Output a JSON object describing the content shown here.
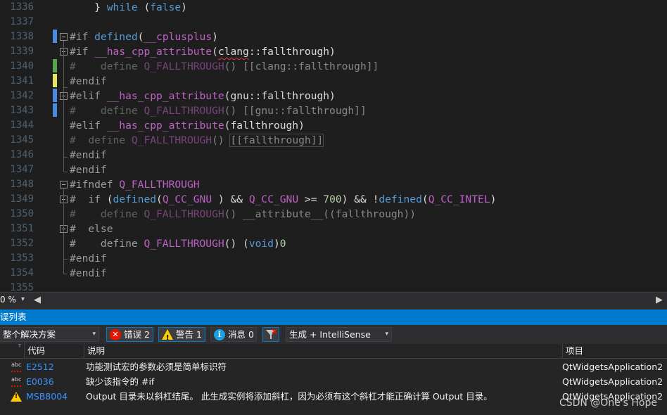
{
  "editor": {
    "line_numbers": [
      "1336",
      "1337",
      "1338",
      "1339",
      "1340",
      "1341",
      "1342",
      "1343",
      "1344",
      "1345",
      "1346",
      "1347",
      "1348",
      "1349",
      "1350",
      "1351",
      "1352",
      "1353",
      "1354",
      "1355"
    ],
    "lines": [
      {
        "segs": [
          [
            "",
            "    } "
          ],
          [
            "k",
            "while"
          ],
          [
            "",
            " ("
          ],
          [
            "k",
            "false"
          ],
          [
            "",
            ")"
          ]
        ]
      },
      {
        "segs": []
      },
      {
        "segs": [
          [
            "pp",
            "#if "
          ],
          [
            "k",
            "defined"
          ],
          [
            "",
            "("
          ],
          [
            "macro",
            "__cplusplus"
          ],
          [
            "",
            ")"
          ]
        ]
      },
      {
        "segs": [
          [
            "pp",
            "#if "
          ],
          [
            "macro",
            "__has_cpp_attribute"
          ],
          [
            "",
            "("
          ],
          [
            "squig",
            "clang"
          ],
          [
            "",
            "::fallthrough)"
          ]
        ]
      },
      {
        "dis": true,
        "segs": [
          [
            "pp",
            "#    define "
          ],
          [
            "macro",
            "Q_FALLTHROUGH"
          ],
          [
            "",
            "() [[clang::fallthrough]]"
          ]
        ]
      },
      {
        "segs": [
          [
            "pp",
            "#endif"
          ]
        ]
      },
      {
        "segs": [
          [
            "pp",
            "#elif "
          ],
          [
            "macro",
            "__has_cpp_attribute"
          ],
          [
            "",
            "(gnu::fallthrough)"
          ]
        ]
      },
      {
        "dis": true,
        "segs": [
          [
            "pp",
            "#    define "
          ],
          [
            "macro",
            "Q_FALLTHROUGH"
          ],
          [
            "",
            "() [[gnu::fallthrough]]"
          ]
        ]
      },
      {
        "segs": [
          [
            "pp",
            "#elif "
          ],
          [
            "macro",
            "__has_cpp_attribute"
          ],
          [
            "",
            "(fallthrough)"
          ]
        ]
      },
      {
        "dis": true,
        "segs": [
          [
            "pp",
            "#  define "
          ],
          [
            "macro",
            "Q_FALLTHROUGH"
          ],
          [
            "",
            "() [[fallthrough]]"
          ]
        ]
      },
      {
        "segs": [
          [
            "pp",
            "#endif"
          ]
        ]
      },
      {
        "segs": [
          [
            "pp",
            "#endif"
          ]
        ]
      },
      {
        "segs": [
          [
            "pp",
            "#ifndef "
          ],
          [
            "macro",
            "Q_FALLTHROUGH"
          ]
        ]
      },
      {
        "segs": [
          [
            "pp",
            "#  if "
          ],
          [
            "",
            "("
          ],
          [
            "k",
            "defined"
          ],
          [
            "",
            "("
          ],
          [
            "macro",
            "Q_CC_GNU"
          ],
          [
            "",
            " ) && "
          ],
          [
            "macro",
            "Q_CC_GNU"
          ],
          [
            "",
            " >= "
          ],
          [
            "num",
            "700"
          ],
          [
            "",
            ") && !"
          ],
          [
            "k",
            "defined"
          ],
          [
            "",
            "("
          ],
          [
            "macro",
            "Q_CC_INTEL"
          ],
          [
            "",
            ")"
          ]
        ]
      },
      {
        "dis": true,
        "segs": [
          [
            "pp",
            "#    define "
          ],
          [
            "macro",
            "Q_FALLTHROUGH"
          ],
          [
            "",
            "() __attribute__((fallthrough))"
          ]
        ]
      },
      {
        "segs": [
          [
            "pp",
            "#  else"
          ]
        ]
      },
      {
        "segs": [
          [
            "pp",
            "#    define "
          ],
          [
            "macro",
            "Q_FALLTHROUGH"
          ],
          [
            "",
            "() ("
          ],
          [
            "k",
            "void"
          ],
          [
            "",
            ")"
          ],
          [
            "num",
            "0"
          ]
        ]
      },
      {
        "segs": [
          [
            "pp",
            "#endif"
          ]
        ]
      },
      {
        "segs": [
          [
            "pp",
            "#endif"
          ]
        ]
      },
      {
        "segs": []
      }
    ]
  },
  "statusbar": {
    "zoom": "0 %",
    "nav_prev": "◀",
    "nav_next": "▶"
  },
  "error_list": {
    "title": "误列表",
    "scope": "整个解决方案",
    "errors_label": "错误 2",
    "warnings_label": "警告 1",
    "messages_label": "消息 0",
    "build_filter": "生成 + IntelliSense",
    "headers": {
      "code": "代码",
      "description": "说明",
      "project": "项目"
    },
    "rows": [
      {
        "severity": "error",
        "code": "E2512",
        "description": "功能测试宏的参数必须是简单标识符",
        "project": "QtWidgetsApplication2"
      },
      {
        "severity": "error",
        "code": "E0036",
        "description": "缺少该指令的 #if",
        "project": "QtWidgetsApplication2"
      },
      {
        "severity": "warning",
        "code": "MSB8004",
        "description": "Output 目录未以斜杠结尾。 此生成实例将添加斜杠，因为必须有这个斜杠才能正确计算 Output 目录。",
        "project": "QtWidgetsApplication2"
      }
    ]
  },
  "watermark": "CSDN @One's Hope",
  "colors": {
    "accent": "#007acc",
    "error": "#e51400",
    "warning": "#ffcc00",
    "link": "#3794ff"
  }
}
